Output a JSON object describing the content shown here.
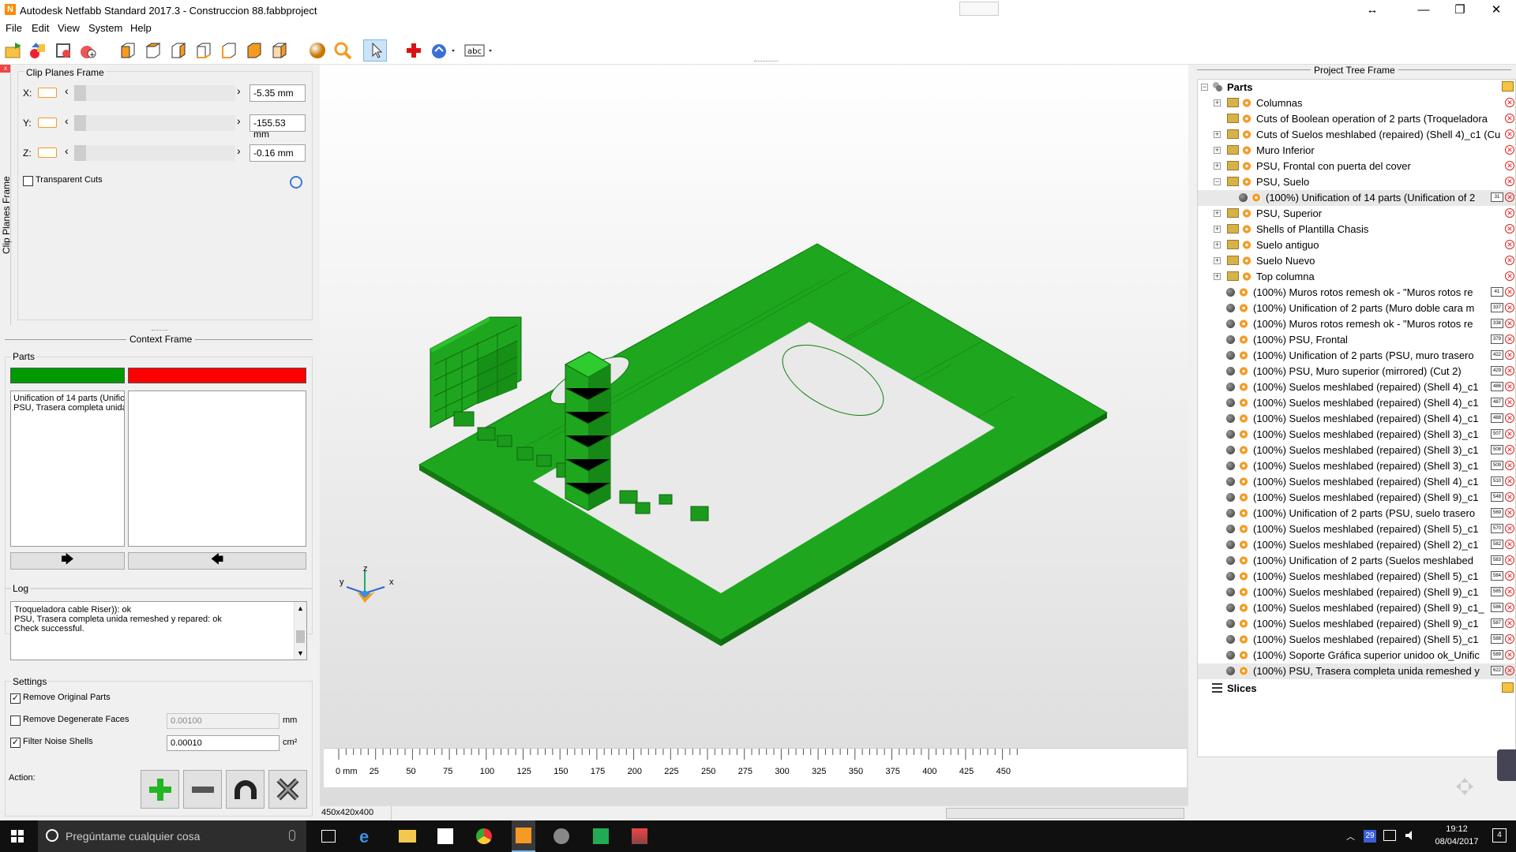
{
  "window": {
    "title": "Autodesk Netfabb Standard 2017.3 - Construccion 88.fabbproject"
  },
  "menu": [
    "File",
    "Edit",
    "View",
    "System",
    "Help"
  ],
  "clip_planes": {
    "frame_title": "Clip Planes Frame",
    "side_tab": "Clip Planes Frame",
    "x_label": "X:",
    "x_value": "-5.35 mm",
    "y_label": "Y:",
    "y_value": "-155.53 mm",
    "z_label": "Z:",
    "z_value": "-0.16 mm",
    "transparent_cuts": "Transparent Cuts",
    "transparent_cuts_checked": false
  },
  "context": {
    "frame_title": "Context Frame",
    "parts_label": "Parts",
    "left_list": [
      "Unification of 14 parts (Unific",
      "PSU, Trasera completa unida"
    ],
    "right_list": [],
    "green_color": "#009900",
    "red_color": "#ff0000"
  },
  "log": {
    "label": "Log",
    "lines": [
      "Troqueladora cable Riser)): ok",
      "PSU, Trasera completa unida remeshed y repared: ok",
      "Check successful."
    ]
  },
  "settings": {
    "label": "Settings",
    "remove_original": "Remove Original Parts",
    "remove_original_checked": true,
    "remove_degenerate": "Remove Degenerate Faces",
    "remove_degenerate_checked": false,
    "degenerate_value": "0.00100",
    "degenerate_unit": "mm",
    "filter_noise": "Filter Noise Shells",
    "filter_noise_checked": true,
    "noise_value": "0.00010",
    "noise_unit": "cm²"
  },
  "action": {
    "label": "Action:"
  },
  "viewport": {
    "status": "450x420x400",
    "ruler_labels": [
      "0 mm",
      "25",
      "50",
      "75",
      "100",
      "125",
      "150",
      "175",
      "200",
      "225",
      "250",
      "275",
      "300",
      "325",
      "350",
      "375",
      "400",
      "425",
      "450"
    ],
    "axis_z": "z",
    "axis_y": "y",
    "axis_x": "x",
    "model_color": "#1fa61f"
  },
  "tree": {
    "frame_title": "Project Tree Frame",
    "root": "Parts",
    "slices": "Slices",
    "groups": [
      {
        "label": "Columnas",
        "expanded": false
      },
      {
        "label": "Cuts of Boolean operation of 2 parts (Troqueladora",
        "expanded": null
      },
      {
        "label": "Cuts of Suelos meshlabed (repaired) (Shell 4)_c1 (Cu",
        "expanded": false
      },
      {
        "label": "Muro Inferior",
        "expanded": false
      },
      {
        "label": "PSU, Frontal con puerta del cover",
        "expanded": false
      },
      {
        "label": "PSU, Suelo",
        "expanded": true
      }
    ],
    "child": {
      "label": "(100%) Unification of 14 parts (Unification of 2",
      "num": "31"
    },
    "groups2": [
      {
        "label": "PSU, Superior"
      },
      {
        "label": "Shells of Plantilla Chasis"
      },
      {
        "label": "Suelo antiguo"
      },
      {
        "label": "Suelo Nuevo"
      },
      {
        "label": "Top columna"
      }
    ],
    "parts": [
      {
        "label": "(100%) Muros rotos remesh ok - \"Muros rotos re",
        "num": "41"
      },
      {
        "label": "(100%) Unification of 2 parts (Muro doble cara m",
        "num": "337"
      },
      {
        "label": "(100%) Muros rotos remesh ok - \"Muros rotos re",
        "num": "338"
      },
      {
        "label": "(100%) PSU, Frontal",
        "num": "379"
      },
      {
        "label": "(100%) Unification of 2 parts (PSU, muro trasero",
        "num": "422"
      },
      {
        "label": "(100%) PSU, Muro superior (mirrored) (Cut 2)",
        "num": "429"
      },
      {
        "label": "(100%) Suelos meshlabed (repaired) (Shell 4)_c1",
        "num": "486"
      },
      {
        "label": "(100%) Suelos meshlabed (repaired) (Shell 4)_c1",
        "num": "487"
      },
      {
        "label": "(100%) Suelos meshlabed (repaired) (Shell 4)_c1",
        "num": "488"
      },
      {
        "label": "(100%) Suelos meshlabed (repaired) (Shell 3)_c1",
        "num": "507"
      },
      {
        "label": "(100%) Suelos meshlabed (repaired) (Shell 3)_c1",
        "num": "508"
      },
      {
        "label": "(100%) Suelos meshlabed (repaired) (Shell 3)_c1",
        "num": "509"
      },
      {
        "label": "(100%) Suelos meshlabed (repaired) (Shell 4)_c1",
        "num": "510"
      },
      {
        "label": "(100%) Suelos meshlabed (repaired) (Shell 9)_c1",
        "num": "548"
      },
      {
        "label": "(100%) Unification of 2 parts (PSU, suelo trasero",
        "num": "569"
      },
      {
        "label": "(100%) Suelos meshlabed (repaired) (Shell 5)_c1",
        "num": "570"
      },
      {
        "label": "(100%) Suelos meshlabed (repaired) (Shell 2)_c1",
        "num": "582"
      },
      {
        "label": "(100%) Unification of 2 parts (Suelos meshlabed",
        "num": "583"
      },
      {
        "label": "(100%) Suelos meshlabed (repaired) (Shell 5)_c1",
        "num": "584"
      },
      {
        "label": "(100%) Suelos meshlabed (repaired) (Shell 9)_c1",
        "num": "585"
      },
      {
        "label": "(100%) Suelos meshlabed (repaired) (Shell 9)_c1_",
        "num": "586"
      },
      {
        "label": "(100%) Suelos meshlabed (repaired) (Shell 9)_c1",
        "num": "587"
      },
      {
        "label": "(100%) Suelos meshlabed (repaired) (Shell 5)_c1",
        "num": "588"
      },
      {
        "label": "(100%) Soporte Gráfica superior unidoo ok_Unific",
        "num": "589"
      },
      {
        "label": "(100%) PSU, Trasera completa unida remeshed y",
        "num": "622"
      }
    ]
  },
  "taskbar": {
    "search_placeholder": "Pregúntame cualquier cosa",
    "time": "19:12",
    "date": "08/04/2017",
    "badge": "29",
    "notif": "4"
  }
}
